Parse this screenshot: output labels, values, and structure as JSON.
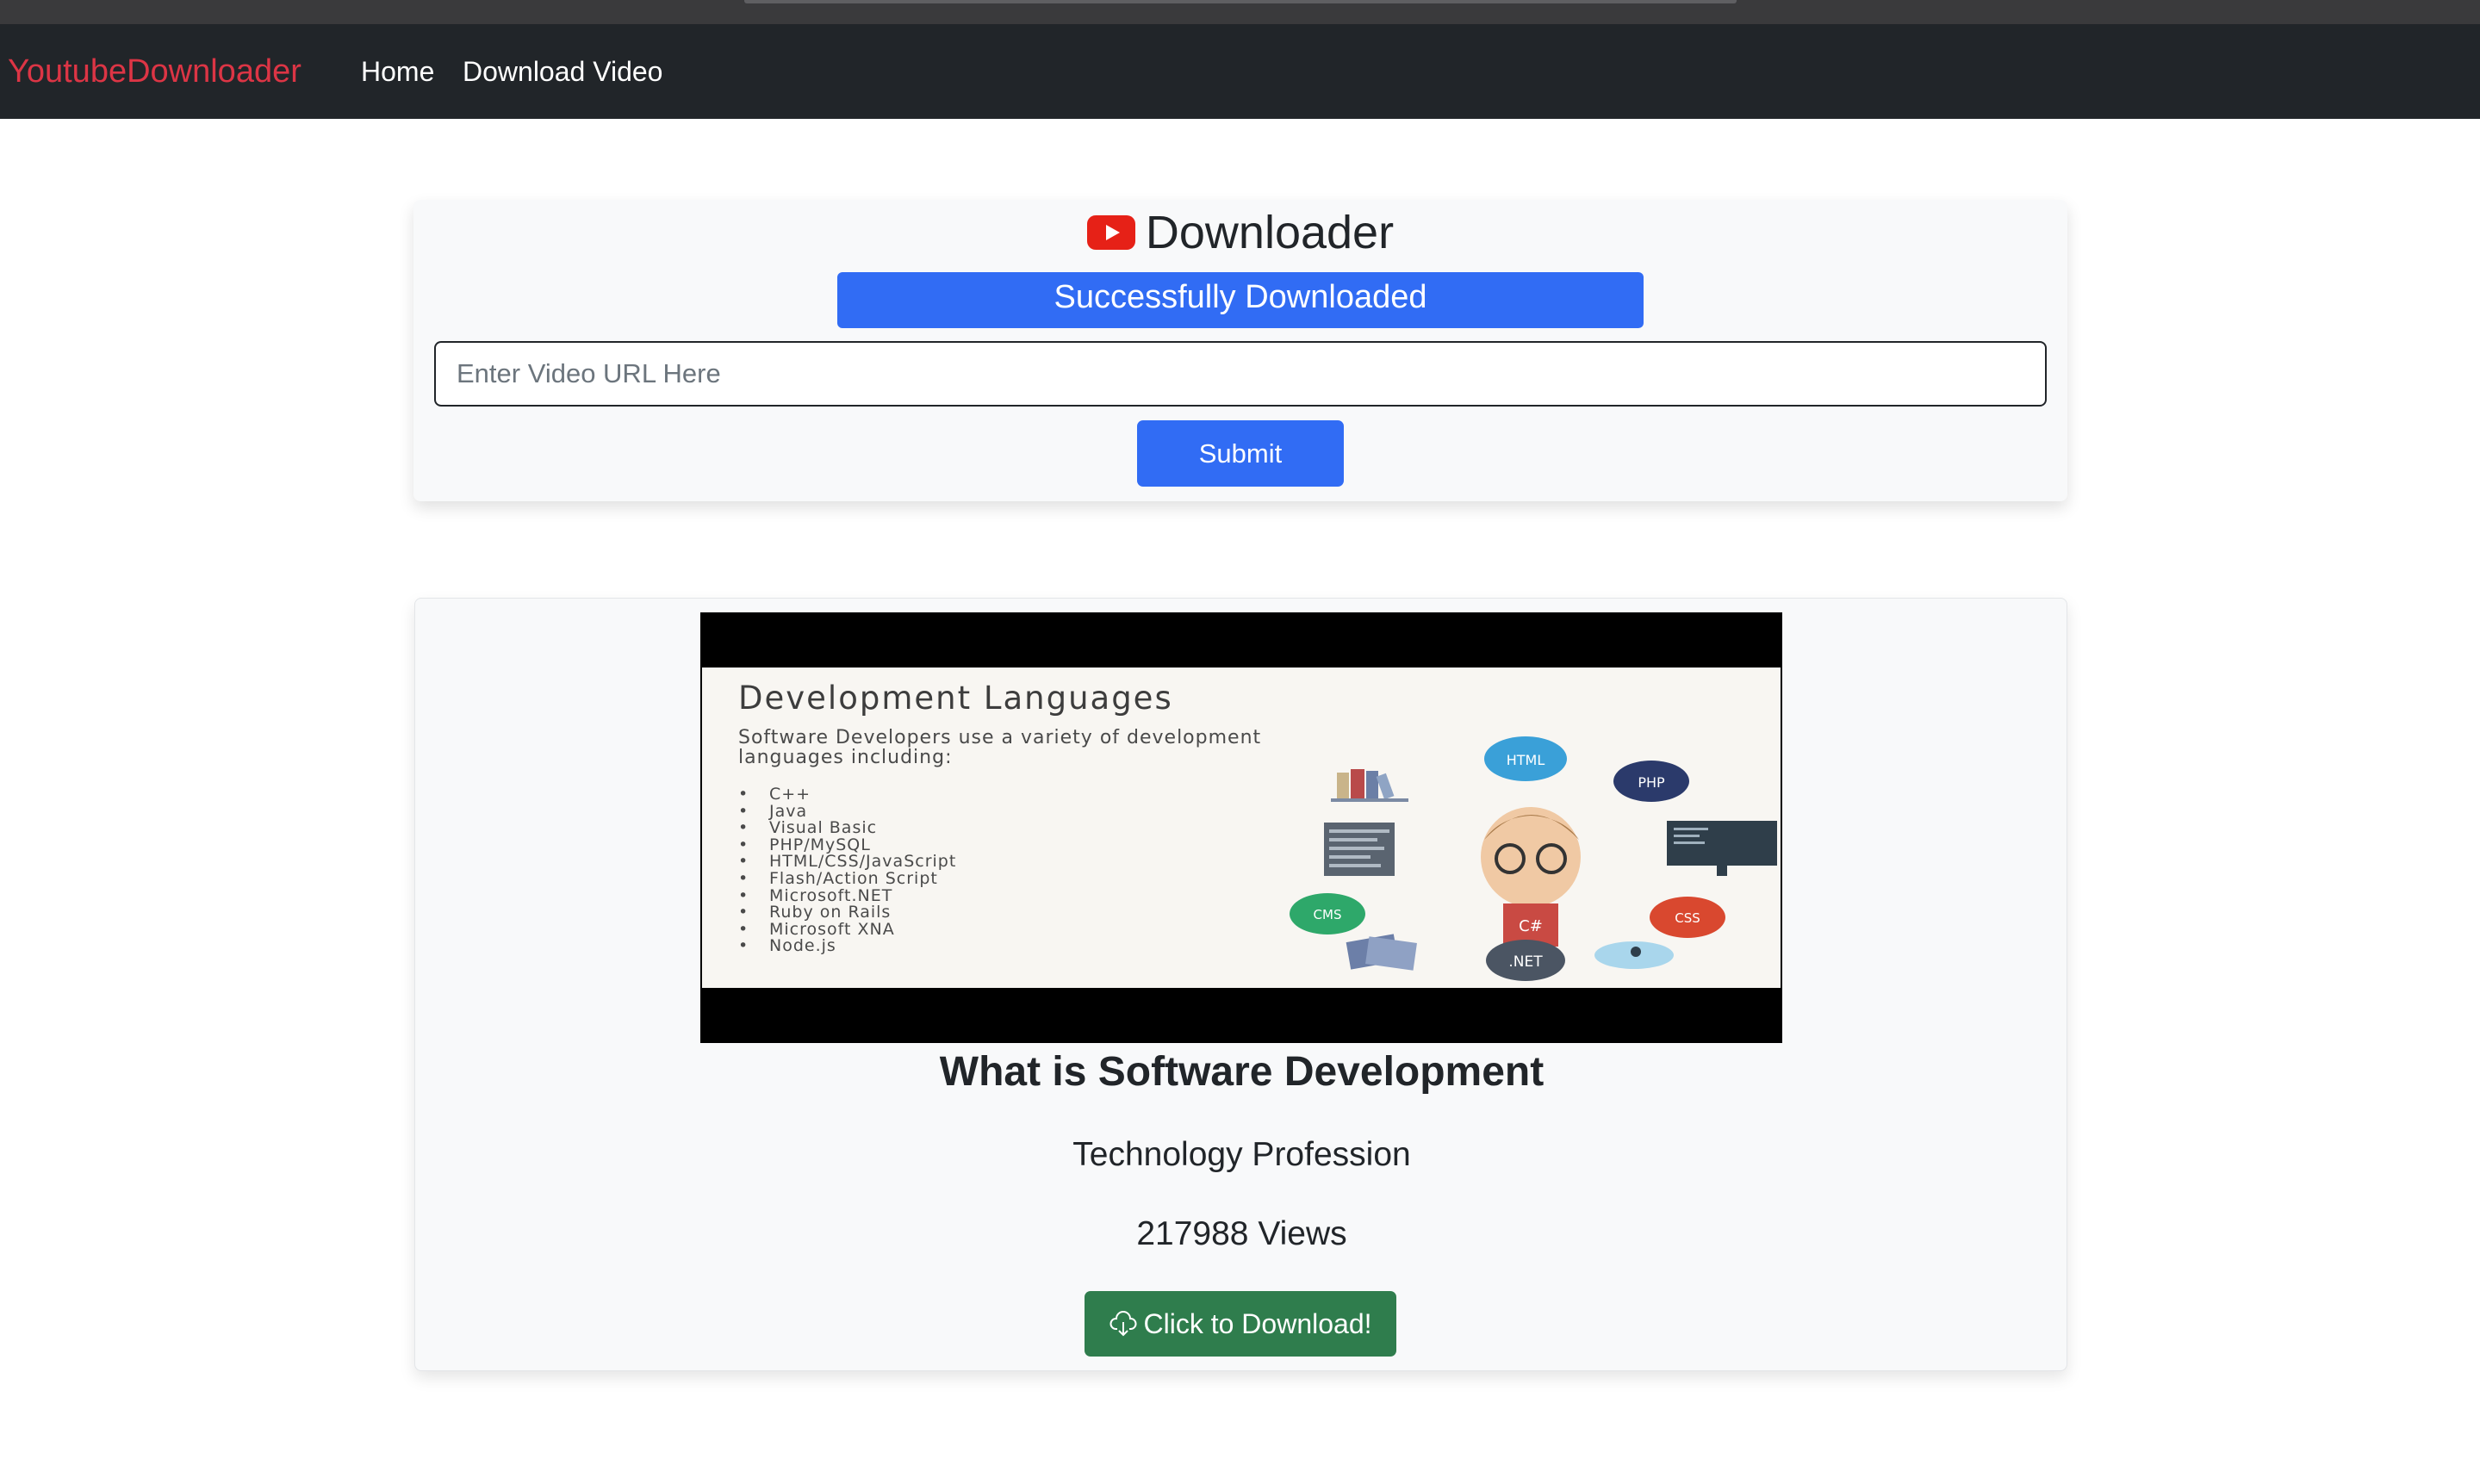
{
  "navbar": {
    "brand": "YoutubeDownloader",
    "links": [
      "Home",
      "Download Video"
    ]
  },
  "form": {
    "title": "Downloader",
    "success_message": "Successfully Downloaded",
    "url_placeholder": "Enter Video URL Here",
    "url_value": "",
    "submit_label": "Submit"
  },
  "video": {
    "thumbnail": {
      "slide_title": "Development Languages",
      "slide_subtitle": "Software Developers use a variety of development languages including:",
      "slide_items": [
        "C++",
        "Java",
        "Visual Basic",
        "PHP/MySQL",
        "HTML/CSS/JavaScript",
        "Flash/Action Script",
        "Microsoft.NET",
        "Ruby on Rails",
        "Microsoft XNA",
        "Node.js"
      ],
      "badges": [
        "HTML",
        "PHP",
        "CMS",
        "C#",
        "CSS",
        ".NET"
      ]
    },
    "title": "What is Software Development",
    "channel": "Technology Profession",
    "views": "217988 Views",
    "download_label": "Click to Download!"
  },
  "icons": {
    "logo": "youtube-play-icon",
    "download": "cloud-download-icon"
  },
  "colors": {
    "navbar_bg": "#212529",
    "brand": "#dc3545",
    "primary": "#316cf4",
    "success": "#2f7d4d",
    "youtube_red": "#e62117"
  }
}
